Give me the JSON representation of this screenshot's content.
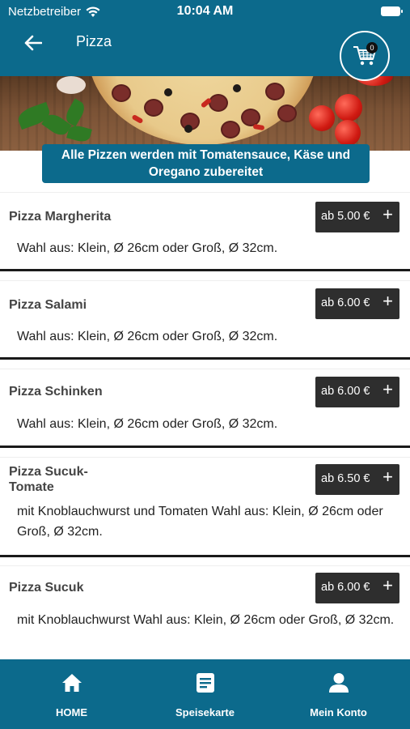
{
  "status_bar": {
    "carrier": "Netzbetreiber",
    "time": "10:04 AM"
  },
  "header": {
    "title": "Pizza",
    "cart_count": "0"
  },
  "banner": {
    "text_line1": "Alle Pizzen werden mit Tomatensauce, Käse und",
    "text_line2": "Oregano zubereitet"
  },
  "items": [
    {
      "name": "Pizza Margherita",
      "price": "ab 5.00 €",
      "add": "+",
      "description": "Wahl aus: Klein, Ø 26cm oder Groß, Ø 32cm."
    },
    {
      "name": "Pizza Salami",
      "price": "ab 6.00 €",
      "add": "+",
      "description": "Wahl aus: Klein, Ø 26cm oder Groß, Ø 32cm."
    },
    {
      "name": "Pizza Schinken",
      "price": "ab 6.00 €",
      "add": "+",
      "description": "Wahl aus: Klein, Ø 26cm oder Groß, Ø 32cm."
    },
    {
      "name_line1": "Pizza Sucuk-",
      "name_line2": "Tomate",
      "price": "ab 6.50 €",
      "add": "+",
      "description": "mit Knoblauchwurst und Tomaten Wahl aus: Klein, Ø 26cm oder Groß, Ø 32cm."
    },
    {
      "name": "Pizza Sucuk",
      "price": "ab 6.00 €",
      "add": "+",
      "description": "mit Knoblauchwurst Wahl aus: Klein, Ø 26cm oder Groß, Ø 32cm."
    }
  ],
  "tabbar": {
    "home": {
      "label": "HOME",
      "icon": "home-icon"
    },
    "menu": {
      "label": "Speisekarte",
      "icon": "menu-card-icon"
    },
    "account": {
      "label": "Mein Konto",
      "icon": "user-icon"
    }
  },
  "colors": {
    "primary": "#0c6a8c",
    "price_button": "#2e2e2e"
  }
}
